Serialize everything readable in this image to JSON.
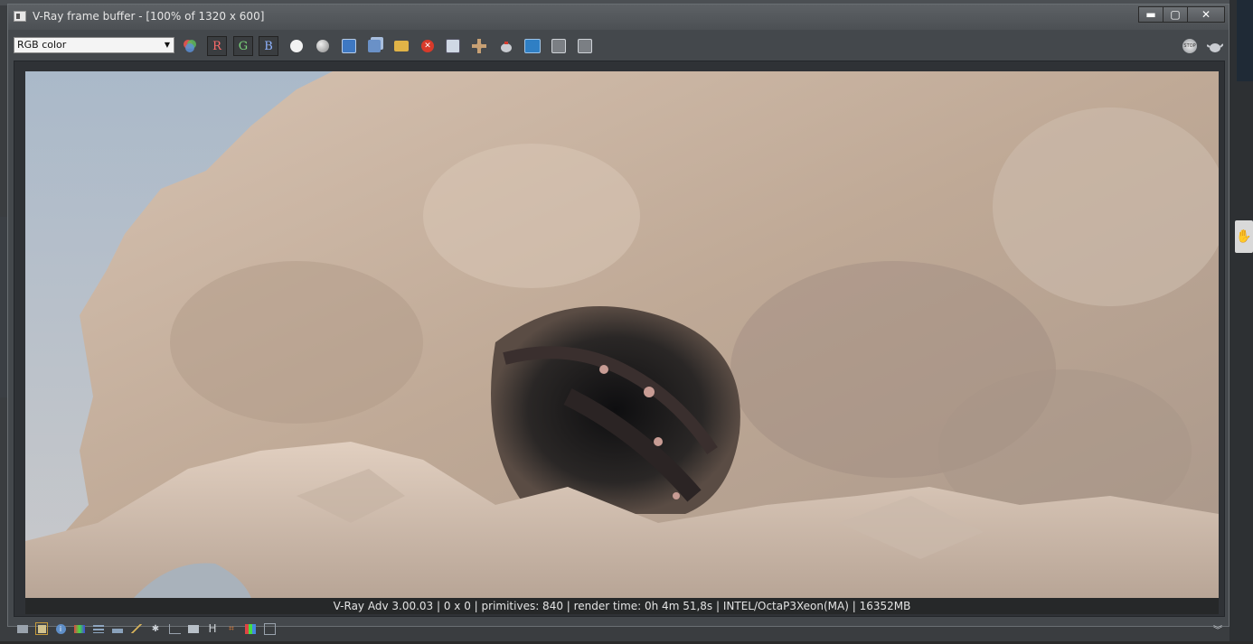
{
  "window": {
    "title": "V-Ray frame buffer - [100% of 1320 x 600]",
    "min_label": "▬",
    "max_label": "▢",
    "close_label": "✕"
  },
  "toolbar": {
    "channel_select": "RGB color",
    "red_label": "R",
    "green_label": "G",
    "blue_label": "B"
  },
  "status": {
    "text": "V-Ray Adv 3.00.03 | 0 x 0 | primitives: 840 | render time:  0h  4m 51,8s | INTEL/OctaP3Xeon(MA) | 16352MB"
  },
  "bottom": {
    "history_label": "H"
  },
  "colors": {
    "sky": "#b7c3cf",
    "rock": "#c9b2a0",
    "cave": "#1e1e1f",
    "accent_red": "#d83a2a",
    "accent_blue": "#2f7fc4"
  }
}
